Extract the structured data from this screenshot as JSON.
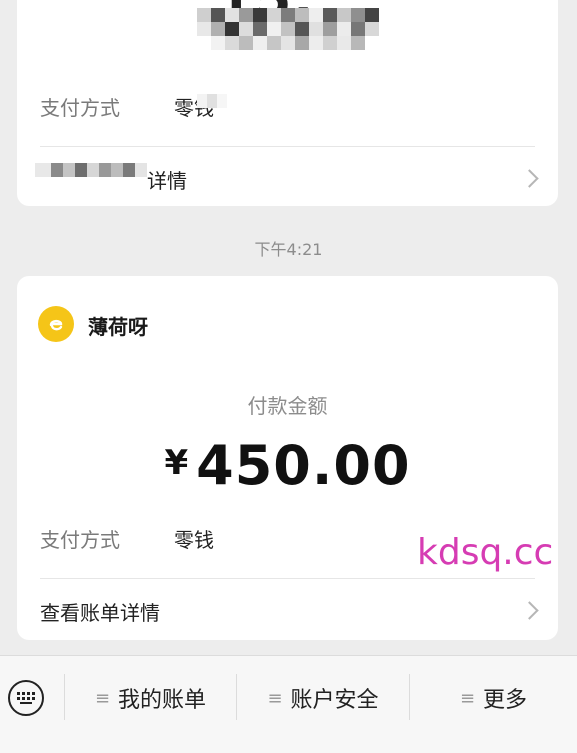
{
  "previous_message": {
    "amount_partial": "15.",
    "pay_method_label": "支付方式",
    "pay_method_value": "零钱",
    "detail_link": "详情"
  },
  "timestamp": "下午4:21",
  "message": {
    "merchant_name": "薄荷呀",
    "pay_label": "付款金额",
    "currency": "¥",
    "amount": "450.00",
    "pay_method_label": "支付方式",
    "pay_method_value": "零钱",
    "detail_link": "查看账单详情"
  },
  "watermark": "kdsq.cc",
  "bottom_menu": {
    "items": [
      {
        "label": "我的账单",
        "icon": "menu-lines-icon"
      },
      {
        "label": "账户安全",
        "icon": "menu-lines-icon"
      },
      {
        "label": "更多",
        "icon": "menu-lines-icon"
      }
    ],
    "keyboard_icon": "keyboard-icon",
    "menu_glyph": "≡"
  }
}
